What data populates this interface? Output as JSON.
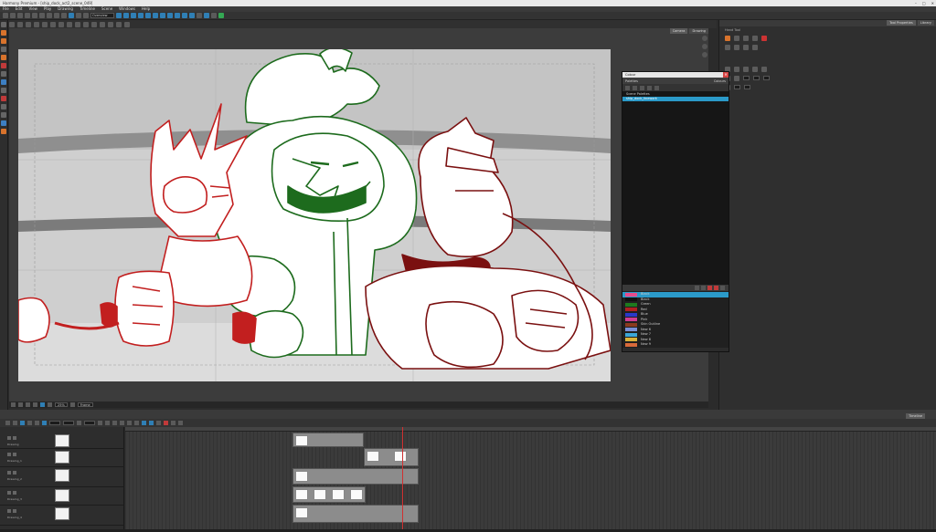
{
  "window": {
    "title": "Harmony Premium - [ship_dock_act2_scene_049]"
  },
  "menu": [
    "File",
    "Edit",
    "View",
    "Play",
    "Drawing",
    "Timeline",
    "Scene",
    "Windows",
    "Help"
  ],
  "toolbar": {
    "mode": "Overview"
  },
  "viewport": {
    "tabs": [
      "Camera",
      "Drawing"
    ],
    "zoom": "25%",
    "field": "Frame"
  },
  "right_panel": {
    "tabs": [
      "Tool Properties",
      "Library"
    ],
    "label": "Hand Tool"
  },
  "colour_window": {
    "title": "Colour",
    "header_left": "Palettes",
    "header_right": "Colours",
    "palettes": [
      {
        "name": "Scene Palettes",
        "selected": false
      },
      {
        "name": "ship_dock_linework",
        "selected": true
      }
    ],
    "colours": [
      {
        "name": "Black",
        "swatch": "#e64b8c",
        "selected": true
      },
      {
        "name": "Black",
        "swatch": "#111111",
        "selected": false
      },
      {
        "name": "Green",
        "swatch": "#1e7a1e",
        "selected": false
      },
      {
        "name": "Red",
        "swatch": "#b02020",
        "selected": false
      },
      {
        "name": "Blue",
        "swatch": "#2a38c9",
        "selected": false
      },
      {
        "name": "Pink",
        "swatch": "#d03c92",
        "selected": false
      },
      {
        "name": "Skin Outline",
        "swatch": "#8a3a1e",
        "selected": false
      },
      {
        "name": "New 6",
        "swatch": "#7a8fd6",
        "selected": false
      },
      {
        "name": "New 7",
        "swatch": "#3aa6d8",
        "selected": false
      },
      {
        "name": "New 8",
        "swatch": "#d8b23a",
        "selected": false
      },
      {
        "name": "New 9",
        "swatch": "#d86a3a",
        "selected": false
      }
    ]
  },
  "timeline": {
    "tab": "Timeline",
    "layers": [
      {
        "name": "Drawing"
      },
      {
        "name": "Drawing_1"
      },
      {
        "name": "Drawing_2"
      },
      {
        "name": "Drawing_3"
      },
      {
        "name": "Drawing_4"
      }
    ]
  },
  "colors": {
    "accent": "#2b9ac9",
    "green_line": "#1d6b1d",
    "red_line": "#c21f1f",
    "brown_line": "#7a1010",
    "playhead": "#d03030"
  }
}
